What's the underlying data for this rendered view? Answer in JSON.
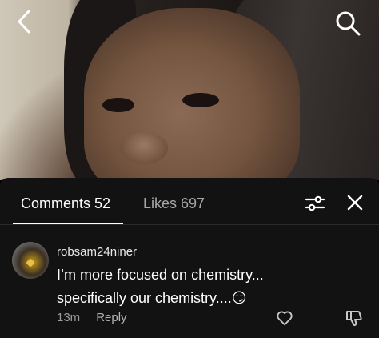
{
  "tabs": {
    "comments": "Comments 52",
    "likes": "Likes 697"
  },
  "comment": {
    "username": "robsam24niner",
    "text": "I’m more focused on chemistry... specifically our chemistry....😏",
    "time": "13m",
    "reply": "Reply"
  }
}
